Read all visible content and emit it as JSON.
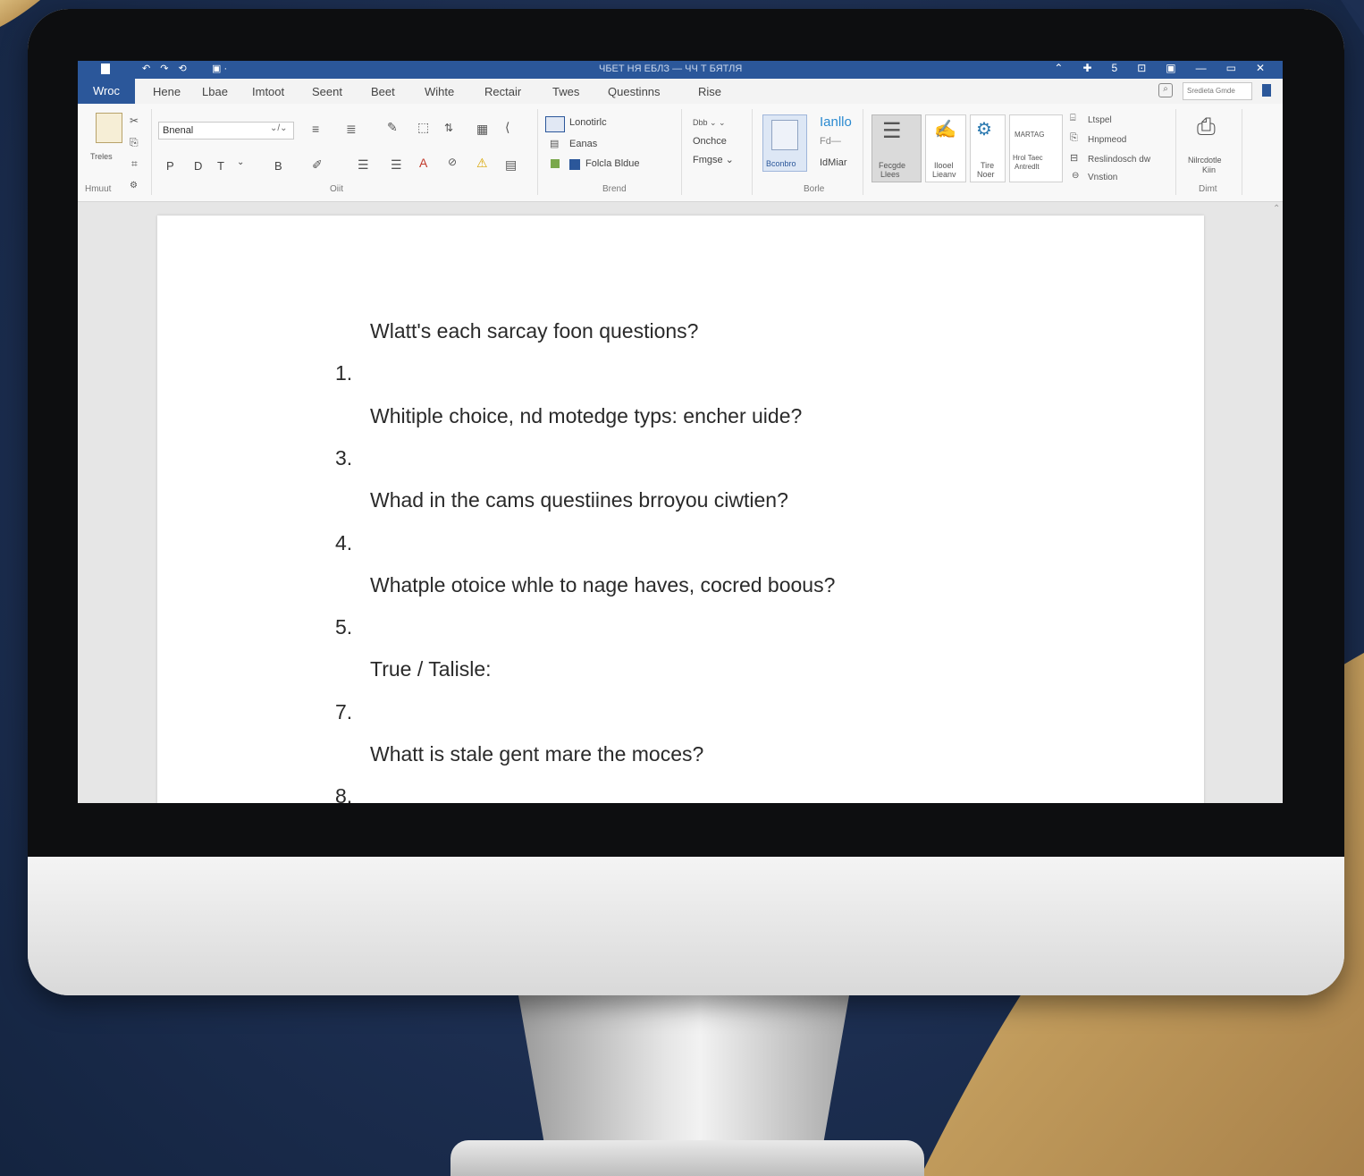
{
  "window": {
    "title": "ЧБЕТ НЯ ЕБЛЗ — ЧЧ Т БЯТЛЯ",
    "quick_access": "↶ ↷ ⟲",
    "quick_access_2": "▣ ·",
    "controls": [
      "⌃",
      "✚",
      "5",
      "⊡",
      "▣",
      "—",
      "▭",
      "✕"
    ]
  },
  "tabs": {
    "file": "Wroc",
    "items": [
      "Hene",
      "Lbae",
      "Imtoot",
      "Seent",
      "Beet",
      "Wihte",
      "Rectair",
      "Twes",
      "Questinns",
      "Rise"
    ]
  },
  "search": {
    "placeholder": "Sredieta Gmde"
  },
  "ribbon": {
    "clipboard": {
      "paste_label": "Treles",
      "group_label": "Hmuut"
    },
    "font": {
      "font_name": "Bnenal",
      "size": "⌄/⌄",
      "format_row": [
        "P",
        "D",
        "T",
        "⌄",
        "В"
      ],
      "group_label": "Oiit"
    },
    "paragraph": {
      "items": [
        "Lonotirlc",
        "Eanas",
        "Folcla Bldue"
      ],
      "group_label": "Brend"
    },
    "options": {
      "items": [
        "Dbb ⌄ ⌄",
        "Onchce",
        "Fmgse ⌄"
      ]
    },
    "styles": {
      "big_label": "Bconbro",
      "chart_label_top": "Ianllo",
      "chart_label_mid": "Fd—",
      "chart_label_bot": "IdMiar",
      "group_label": "Borle"
    },
    "gallery": {
      "items": [
        {
          "line1": "Fecgde",
          "line2": "Llees"
        },
        {
          "line1": "Ilooel",
          "line2": "Lieanv"
        },
        {
          "line1": "Tire",
          "line2": "Noer"
        },
        {
          "line1": "Hrol Taec",
          "line2": "Antredlt"
        }
      ],
      "banner": "MARTAG"
    },
    "editing": {
      "items": [
        "Ltspel",
        "Hnpmeod",
        "Reslindosch dw",
        "Vnstion"
      ]
    },
    "extra": {
      "line1": "Nilrcdotle",
      "line2": "Kiin",
      "group_label": "Dimt"
    }
  },
  "document": {
    "lines": [
      {
        "type": "text",
        "value": "Wlatt's each sarcay foon questions?"
      },
      {
        "type": "num",
        "value": "1."
      },
      {
        "type": "text",
        "value": "Whitiple choice, nd motedge typs: encher uide?"
      },
      {
        "type": "num",
        "value": "3."
      },
      {
        "type": "text",
        "value": "Whad in the cams questiines brroyou ciwtien?"
      },
      {
        "type": "num",
        "value": "4."
      },
      {
        "type": "text",
        "value": "Whatple otoice whle to nage haves, cocred boous?"
      },
      {
        "type": "num",
        "value": "5."
      },
      {
        "type": "text",
        "value": "True / Talisle:"
      },
      {
        "type": "num",
        "value": "7."
      },
      {
        "type": "text",
        "value": "Whatt is stale gent mare the moces?"
      },
      {
        "type": "num",
        "value": "8."
      }
    ]
  },
  "colors": {
    "accent": "#2b579a",
    "background": "#1d2f52",
    "gold": "#c9a667"
  }
}
